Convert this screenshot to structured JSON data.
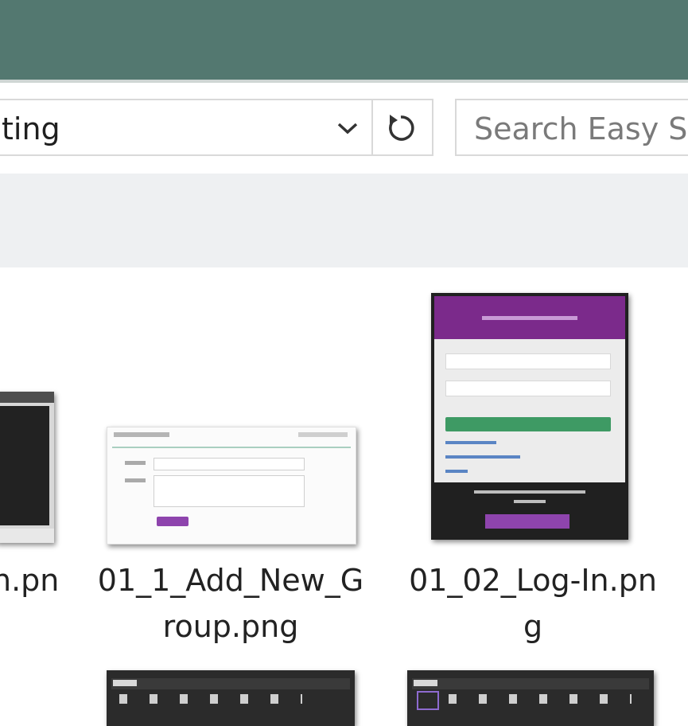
{
  "address_bar": {
    "path_fragment": "ting"
  },
  "search": {
    "placeholder": "Search Easy Se"
  },
  "files": [
    {
      "name_line1": "n.pn",
      "name_line2": ""
    },
    {
      "name_line1": "01_1_Add_New_G",
      "name_line2": "roup.png"
    },
    {
      "name_line1": "01_02_Log-In.pn",
      "name_line2": "g"
    }
  ],
  "colors": {
    "titlebar": "#537870",
    "purple_header": "#7b2a8b",
    "green_button": "#3e9a64"
  }
}
